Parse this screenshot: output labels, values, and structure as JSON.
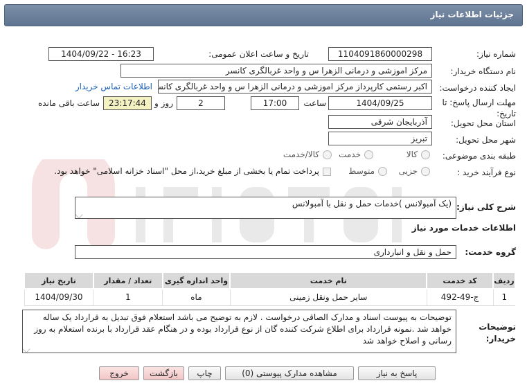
{
  "header": {
    "title": "جزئیات اطلاعات نیاز"
  },
  "fields": {
    "need_number": {
      "label": "شماره نیاز:",
      "value": "1104091860000298"
    },
    "announce": {
      "label": "تاریخ و ساعت اعلان عمومی:",
      "value": "1404/09/22 - 16:23"
    },
    "buyer": {
      "label": "نام دستگاه خریدار:",
      "value": "مرکز اموزشی و درمانی الزهرا س  و واحد غربالگری کانسر"
    },
    "requester": {
      "label": "ایجاد کننده درخواست:",
      "value": "اکبر رستمی کارپرداز مرکز اموزشی و درمانی الزهرا س  و واحد غربالگری کانسر",
      "contact_link": "اطلاعات تماس خریدار"
    },
    "deadline": {
      "label": "مهلت ارسال پاسخ: تا تاریخ:",
      "date": "1404/09/25",
      "time_label": "ساعت",
      "time": "17:00",
      "days": "2",
      "days_label": "روز و",
      "remaining": "23:17:44",
      "remaining_label": "ساعت باقی مانده"
    },
    "province": {
      "label": "استان محل تحویل:",
      "value": "آذربایجان شرقی"
    },
    "city": {
      "label": "شهر محل تحویل:",
      "value": "تبریز"
    },
    "category": {
      "label": "طبقه بندی موضوعی:",
      "options": [
        "کالا",
        "خدمت",
        "کالا/خدمت"
      ]
    },
    "process": {
      "label": "نوع فرآیند خرید :",
      "options": [
        "جزیی",
        "متوسط"
      ],
      "check_text": "پرداخت تمام یا بخشی از مبلغ خرید،از محل \"اسناد خزانه اسلامی\" خواهد بود."
    }
  },
  "summary": {
    "label": "شرح کلی نیاز:",
    "value": "(یک آمبولانس )خدمات حمل و نقل با آمبولانس"
  },
  "services_title": "اطلاعات خدمات مورد نیاز",
  "service_group": {
    "label": "گروه خدمت:",
    "value": "حمل و نقل و انبارداری"
  },
  "table": {
    "headers": [
      "ردیف",
      "کد خدمت",
      "نام خدمت",
      "واحد اندازه گیری",
      "تعداد / مقدار",
      "تاریخ نیاز"
    ],
    "rows": [
      [
        "1",
        "ج-49-492",
        "سایر حمل ونقل زمینی",
        "ماه",
        "1",
        "1404/09/30"
      ]
    ]
  },
  "buyer_notes": {
    "label": "توضیحات خریدار:",
    "value": "توضیحات به پیوست اسناد و مدارک الصاقی درخواست . لازم به توضیح می باشد استعلام فوق تبدیل به قرارداد یک ساله خواهد شد .نمونه قرارداد برای اطلاع شرکت کننده گان از نوع قرارداد بوده و در هنگام عقد قرارداد با برنده استعلام به روز رسانی و اصلاح خواهد شد"
  },
  "buttons": {
    "reply": "پاسخ به نیاز",
    "attachments": "مشاهده مدارک پیوستی (0)",
    "print": "چاپ",
    "back": "بازگشت",
    "exit": "خروج"
  }
}
